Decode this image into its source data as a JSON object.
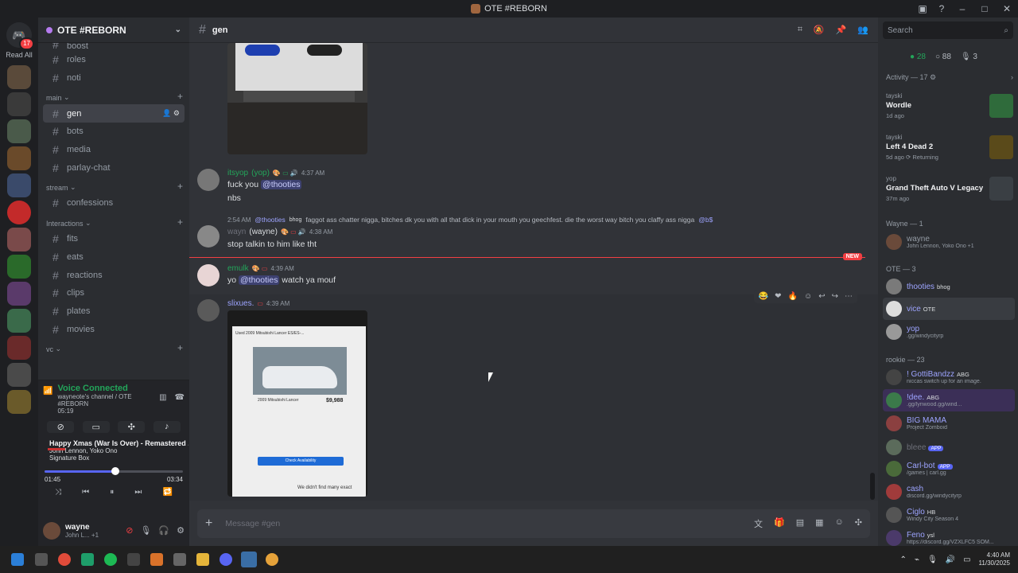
{
  "window": {
    "title": "OTE #REBORN"
  },
  "guilds": {
    "read_all": "Read All",
    "home_badge": "17"
  },
  "server": {
    "name": "OTE #REBORN"
  },
  "channels_top": [
    {
      "name": "boost"
    },
    {
      "name": "roles"
    },
    {
      "name": "noti"
    }
  ],
  "categories": {
    "main": "main",
    "stream": "stream",
    "interactions": "Interactions",
    "vc": "vc"
  },
  "channels_main": [
    {
      "name": "gen"
    },
    {
      "name": "bots"
    },
    {
      "name": "media"
    },
    {
      "name": "parlay-chat"
    }
  ],
  "channels_stream": [
    {
      "name": "confessions"
    }
  ],
  "channels_interactions": [
    {
      "name": "fits"
    },
    {
      "name": "eats"
    },
    {
      "name": "reactions"
    },
    {
      "name": "clips"
    },
    {
      "name": "plates"
    },
    {
      "name": "movies"
    }
  ],
  "voice": {
    "title": "Voice Connected",
    "channel": "wayneote's channel / OTE #REBORN",
    "timer": "05:19"
  },
  "music": {
    "title": "Happy Xmas (War Is Over) - Remastered ...",
    "artist": "John Lennon, Yoko Ono",
    "album": "Signature Box",
    "elapsed": "01:45",
    "duration": "03:34",
    "progress": 0.49
  },
  "user": {
    "name": "wayne",
    "status": "John L... +1"
  },
  "channel": {
    "name": "gen"
  },
  "messages": {
    "m1": {
      "author": "itsyop",
      "nick": "(yop)",
      "time": "4:37 AM",
      "text_pre": "fuck you ",
      "mention": "@thooties",
      "line2": "nbs"
    },
    "m2": {
      "reply_time": "2:54 AM",
      "reply_author": "@thooties",
      "reply_tag": "bhog",
      "reply_text": "faggot ass chatter nigga, bitches dk you with all that dick in your mouth you geechfest. die the worst way bitch you claffy ass nigga",
      "reply_mention": "@b$",
      "author_hidden": "wayn",
      "nick": "(wayne)",
      "time": "4:38 AM",
      "text": "stop talkin to him like tht"
    },
    "m3": {
      "author": "emulk",
      "time": "4:39 AM",
      "text_pre": "yo ",
      "mention": "@thooties",
      "text_post": " watch ya mouf"
    },
    "m4": {
      "author": "slixues.",
      "time": "4:39 AM"
    }
  },
  "new_label": "NEW",
  "listing": {
    "title": "2009 Mitsubishi Lancer",
    "price": "$9,988",
    "button": "Check Availability",
    "footer": "We didn't find many exact",
    "header": "Used 2009 Mitsubishi Lancer ES/ES-..."
  },
  "composer": {
    "placeholder": "Message #gen"
  },
  "members": {
    "search": "Search",
    "online": "28",
    "idle": "88",
    "other": "3",
    "activity_header": "Activity — 17",
    "activities": [
      {
        "user": "tayski",
        "game": "Wordle",
        "when": "1d ago",
        "color": "#2f6b3b"
      },
      {
        "user": "tayski",
        "game": "Left 4 Dead 2",
        "when": "5d ago  ⟳ Returning",
        "color": "#5a4a1a"
      },
      {
        "user": "yop",
        "game": "Grand Theft Auto V Legacy",
        "when": "37m ago",
        "color": "#3a3f44"
      }
    ],
    "wayne_header": "Wayne — 1",
    "wayne": [
      {
        "name": "wayne",
        "status": "John Lennon, Yoko Ono +1",
        "color": "#6a4a3a",
        "ncolor": "#949ba4"
      }
    ],
    "ote_header": "OTE — 3",
    "ote": [
      {
        "name": "thooties",
        "tag": "bhog",
        "status": "",
        "color": "#7a7a7a",
        "ncolor": "#9da4ff"
      },
      {
        "name": "vice",
        "tag": "OTE",
        "status": "",
        "color": "#ddd",
        "ncolor": "#9da4ff"
      },
      {
        "name": "yop",
        "tag": "",
        "status": ".gg/windycityrp",
        "color": "#999",
        "ncolor": "#9da4ff"
      }
    ],
    "rookie_header": "rookie — 23",
    "rookie": [
      {
        "name": "! GottiBandzz",
        "tag": "ABG",
        "status": "niccas switch up for an image.",
        "color": "#444",
        "ncolor": "#9da4ff"
      },
      {
        "name": "!dee.",
        "tag": "ABG",
        "status": ".gg/lynwood.gg/wind...",
        "color": "#3b7a4a",
        "ncolor": "#9da4ff"
      },
      {
        "name": "BIG MAMA",
        "tag": "",
        "status": "Project Zomboid",
        "color": "#8b4040",
        "ncolor": "#9da4ff"
      },
      {
        "name": "bleee",
        "tag": "APP",
        "status": "",
        "color": "#5b6b5b",
        "ncolor": "#6d6f78"
      },
      {
        "name": "Carl-bot",
        "tag": "APP",
        "status": "/games | carl.gg",
        "color": "#4a6a3a",
        "ncolor": "#9da4ff"
      },
      {
        "name": "cash",
        "tag": "",
        "status": "discord.gg/windycityrp",
        "color": "#a03b3b",
        "ncolor": "#9da4ff"
      },
      {
        "name": "Ciglo",
        "tag": "HB",
        "status": "Windy City Season 4",
        "color": "#555",
        "ncolor": "#9da4ff"
      },
      {
        "name": "Feno",
        "tag": "ysl",
        "status": "https://discord.gg/VZXLFC5 SOM...",
        "color": "#4b3a6a",
        "ncolor": "#9da4ff"
      }
    ]
  },
  "taskbar": {
    "time": "4:40 AM",
    "date": "11/30/2025"
  }
}
